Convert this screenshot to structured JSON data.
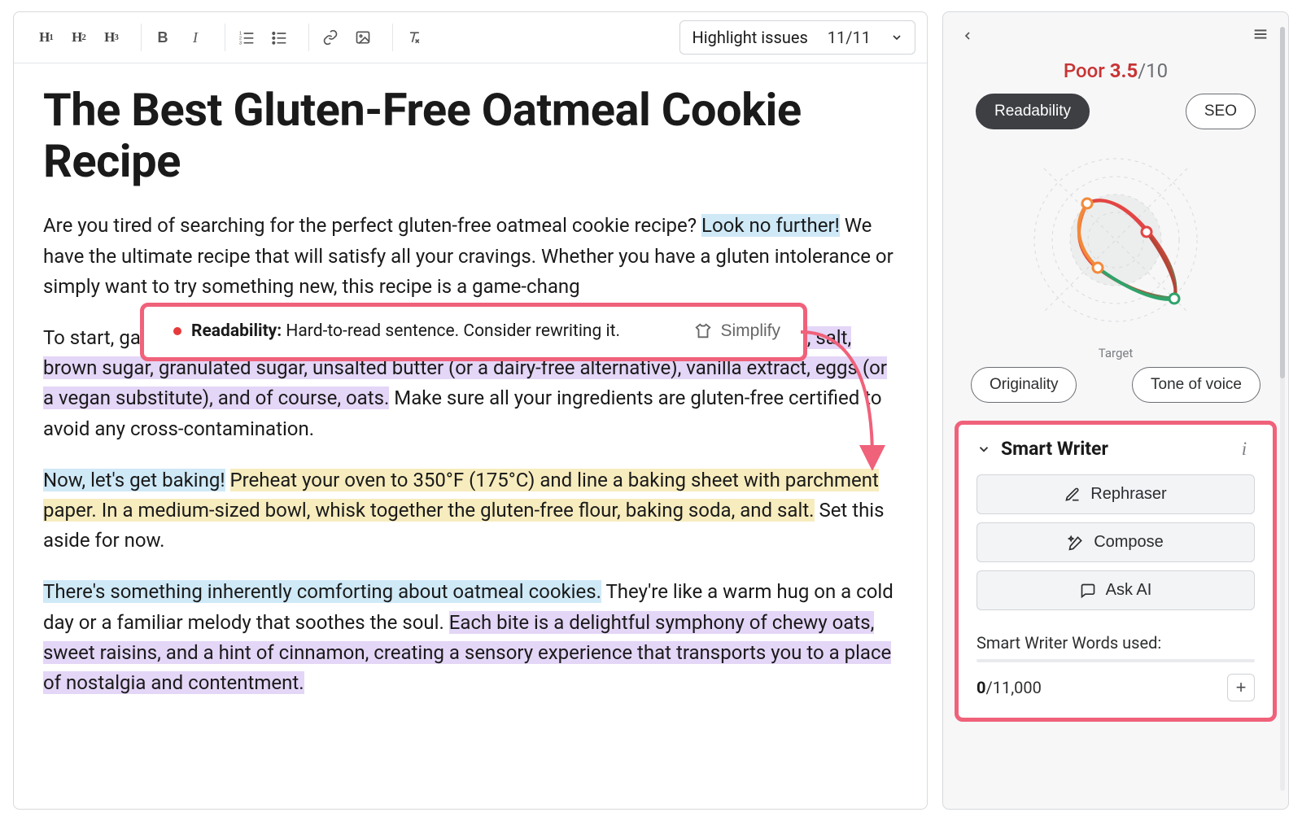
{
  "toolbar": {
    "headings": [
      "H1",
      "H2",
      "H3"
    ],
    "highlight_label": "Highlight issues",
    "highlight_count": "11/11"
  },
  "article": {
    "title": "The Best Gluten-Free Oatmeal Cookie Recipe",
    "p1": {
      "t1": "Are you tired of searching for the perfect gluten-free oatmeal cookie recipe? ",
      "hl_blue": "Look no further!",
      "t2": " We have the ultimate recipe that will satisfy all your cravings. Whether you have a gluten intolerance or simply want to try something new, this recipe is a game-chang"
    },
    "p2": {
      "t1": "To start, gather all the necessary ingredients. ",
      "hl_purple": "You will need gluten-free flour, baking soda, salt, brown sugar, granulated sugar, unsalted butter (or a dairy-free alternative), vanilla extract, eggs (or a vegan substitute), and of course, oats.",
      "t2": " Make sure all your ingredients are gluten-free certified to avoid any cross-contamination."
    },
    "p3": {
      "hl_blue": "Now, let's get baking!",
      "space": " ",
      "hl_yellow": "Preheat your oven to 350°F (175°C) and line a baking sheet with parchment paper. In a medium-sized bowl, whisk together the gluten-free flour, baking soda, and salt.",
      "t2": " Set this aside for now."
    },
    "p4": {
      "hl_blue": "There's something inherently comforting about oatmeal cookies.",
      "t1": " They're like a warm hug on a cold day or a familiar melody that soothes the soul. ",
      "hl_purple": "Each bite is a delightful symphony of chewy oats, sweet raisins, and a hint of cinnamon, creating a sensory experience that transports you to a place of nostalgia and contentment."
    }
  },
  "callout": {
    "label": "Readability:",
    "message": "Hard-to-read sentence. Consider rewriting it.",
    "action": "Simplify"
  },
  "sidebar": {
    "score_label": "Poor",
    "score_value": "3.5",
    "score_outof": "/10",
    "chip_readability": "Readability",
    "chip_seo": "SEO",
    "chip_originality": "Originality",
    "chip_tone": "Tone of voice",
    "target": "Target"
  },
  "smart": {
    "title": "Smart Writer",
    "rephraser": "Rephraser",
    "compose": "Compose",
    "askai": "Ask AI",
    "usage_label": "Smart Writer Words used:",
    "used": "0",
    "limit": "/11,000"
  }
}
